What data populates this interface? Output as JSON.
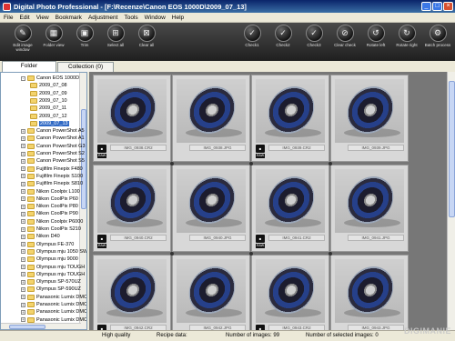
{
  "window": {
    "title": "Digital Photo Professional - [F:\\Recenze\\Canon EOS 1000D\\2009_07_13]"
  },
  "menu": [
    "File",
    "Edit",
    "View",
    "Bookmark",
    "Adjustment",
    "Tools",
    "Window",
    "Help"
  ],
  "toolbar": {
    "left": [
      {
        "label": "Edit image window",
        "icon": "edit-image-icon"
      },
      {
        "label": "Folder view",
        "icon": "folder-view-icon"
      },
      {
        "label": "Trim",
        "icon": "trim-icon"
      },
      {
        "label": "Select all",
        "icon": "select-all-icon"
      },
      {
        "label": "Clear all",
        "icon": "clear-all-icon"
      }
    ],
    "right": [
      {
        "label": "Check1",
        "icon": "check1-icon"
      },
      {
        "label": "Check2",
        "icon": "check2-icon"
      },
      {
        "label": "Check3",
        "icon": "check3-icon"
      },
      {
        "label": "Clear check",
        "icon": "clear-check-icon"
      },
      {
        "label": "Rotate left",
        "icon": "rotate-left-icon"
      },
      {
        "label": "Rotate right",
        "icon": "rotate-right-icon"
      },
      {
        "label": "Batch process",
        "icon": "batch-process-icon"
      }
    ]
  },
  "tabs": [
    {
      "label": "Folder",
      "active": true
    },
    {
      "label": "Collection (0)",
      "active": false
    }
  ],
  "tree": [
    {
      "label": "Canon EOS 1000D",
      "level": 1,
      "expander": "-"
    },
    {
      "label": "2009_07_08",
      "level": 2
    },
    {
      "label": "2009_07_09",
      "level": 2
    },
    {
      "label": "2009_07_10",
      "level": 2
    },
    {
      "label": "2009_07_11",
      "level": 2
    },
    {
      "label": "2009_07_12",
      "level": 2
    },
    {
      "label": "2009_07_13",
      "level": 2,
      "selected": true
    },
    {
      "label": "Canon PowerShot A5",
      "level": 1,
      "expander": "+"
    },
    {
      "label": "Canon PowerShot A1",
      "level": 1,
      "expander": "+"
    },
    {
      "label": "Canon PowerShot G3",
      "level": 1,
      "expander": "+"
    },
    {
      "label": "Canon PowerShot S2",
      "level": 1,
      "expander": "+"
    },
    {
      "label": "Canon PowerShot S5",
      "level": 1,
      "expander": "+"
    },
    {
      "label": "Fujifilm Finepix F480",
      "level": 1,
      "expander": "+"
    },
    {
      "label": "Fujifilm Finepix S100",
      "level": 1,
      "expander": "+"
    },
    {
      "label": "Fujifilm Finepix S810",
      "level": 1,
      "expander": "+"
    },
    {
      "label": "Nikon Coolpix L100",
      "level": 1,
      "expander": "+"
    },
    {
      "label": "Nikon CoolPix P60",
      "level": 1,
      "expander": "+"
    },
    {
      "label": "Nikon CoolPix P80",
      "level": 1,
      "expander": "+"
    },
    {
      "label": "Nikon CoolPix P90",
      "level": 1,
      "expander": "+"
    },
    {
      "label": "Nikon Coolpix P6000",
      "level": 1,
      "expander": "+"
    },
    {
      "label": "Nikon CoolPix S210",
      "level": 1,
      "expander": "+"
    },
    {
      "label": "Nikon D40",
      "level": 1,
      "expander": "+"
    },
    {
      "label": "Olympus FE-370",
      "level": 1,
      "expander": "+"
    },
    {
      "label": "Olympus mju 1050 SW",
      "level": 1,
      "expander": "+"
    },
    {
      "label": "Olympus mju 9000",
      "level": 1,
      "expander": "+"
    },
    {
      "label": "Olympus mju TOUGH",
      "level": 1,
      "expander": "+"
    },
    {
      "label": "Olympus mju TOUGH",
      "level": 1,
      "expander": "+"
    },
    {
      "label": "Olympus SP-570UZ",
      "level": 1,
      "expander": "+"
    },
    {
      "label": "Olympus SP-590UZ",
      "level": 1,
      "expander": "+"
    },
    {
      "label": "Panasonic Lumix DMC",
      "level": 1,
      "expander": "+"
    },
    {
      "label": "Panasonic Lumix DMC",
      "level": 1,
      "expander": "+"
    },
    {
      "label": "Panasonic Lumix DMC",
      "level": 1,
      "expander": "+"
    },
    {
      "label": "Panasonic Lumix DMC",
      "level": 1,
      "expander": "+"
    }
  ],
  "thumbnails": [
    {
      "name": "IMG_0938.CR2",
      "raw": true
    },
    {
      "name": "IMG_0938.JPG",
      "raw": false
    },
    {
      "name": "IMG_0939.CR2",
      "raw": true
    },
    {
      "name": "IMG_0939.JPG",
      "raw": false
    },
    {
      "name": "IMG_0940.CR2",
      "raw": true
    },
    {
      "name": "IMG_0940.JPG",
      "raw": false
    },
    {
      "name": "IMG_0941.CR2",
      "raw": true
    },
    {
      "name": "IMG_0941.JPG",
      "raw": false
    },
    {
      "name": "IMG_0942.CR2",
      "raw": true
    },
    {
      "name": "IMG_0942.JPG",
      "raw": false
    },
    {
      "name": "IMG_0943.CR2",
      "raw": true
    },
    {
      "name": "IMG_0943.JPG",
      "raw": false
    }
  ],
  "badges": {
    "raw": "RAW",
    "camera": "■"
  },
  "status": {
    "quality": "High quality",
    "recipe": "Recipe data:",
    "images": "Number of images: 99",
    "selected": "Number of selected images: 0"
  },
  "watermark": "DIGIMANIE",
  "colors": {
    "selection": "#316ac5",
    "toolbar": "#2b2b2b",
    "grid_background": "#777777"
  }
}
